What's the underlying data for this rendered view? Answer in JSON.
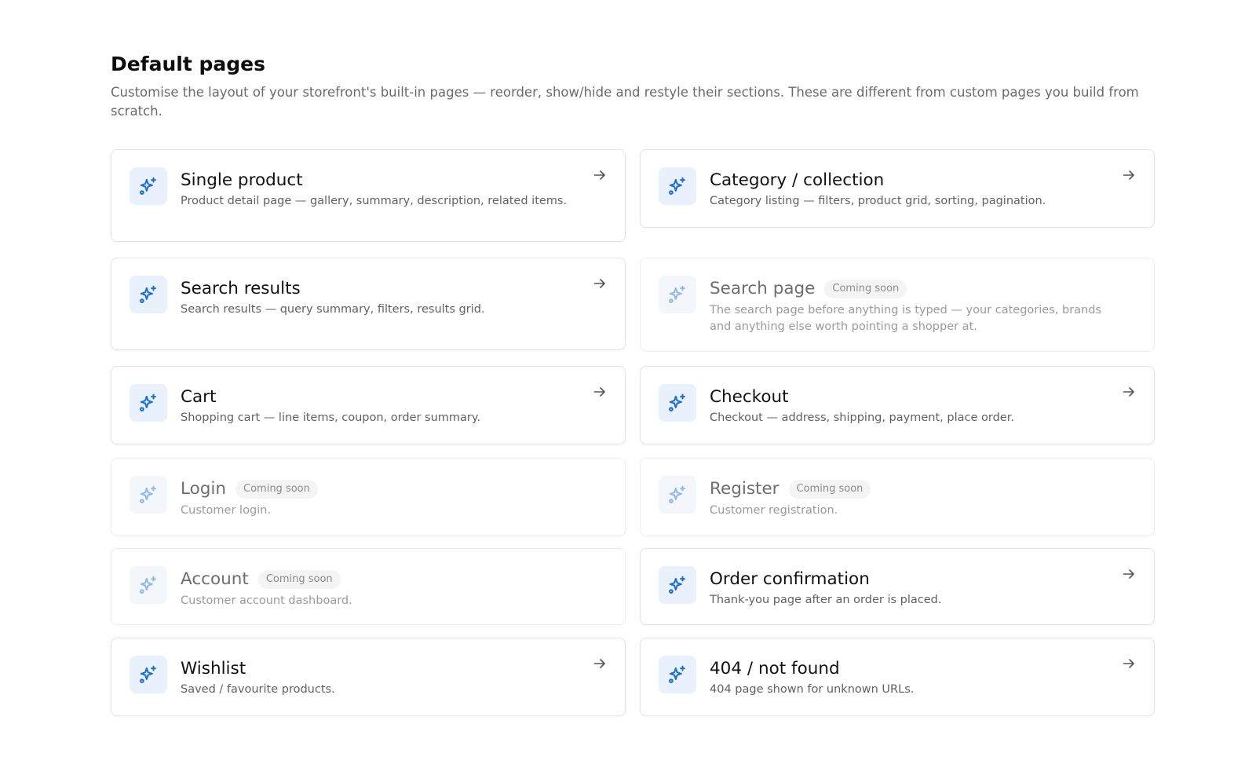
{
  "header": {
    "title": "Default pages",
    "description": "Customise the layout of your storefront's built-in pages — reorder, show/hide and restyle their sections. These are different from custom pages you build from scratch."
  },
  "colors": {
    "accent": "#1f6fd1",
    "icon_bg": "#e8f1fc"
  },
  "cards": [
    {
      "title": "Single product",
      "description": "Product detail page — gallery, summary, description, related items.",
      "badge": "",
      "enabled": true,
      "icon": "sparkles-icon"
    },
    {
      "title": "Category / collection",
      "description": "Category listing — filters, product grid, sorting, pagination.",
      "badge": "",
      "enabled": true,
      "icon": "sparkles-icon"
    },
    {
      "title": "Search results",
      "description": "Search results — query summary, filters, results grid.",
      "badge": "",
      "enabled": true,
      "icon": "sparkles-icon"
    },
    {
      "title": "Search page",
      "description": "The search page before anything is typed — your categories, brands and anything else worth pointing a shopper at.",
      "badge": "Coming soon",
      "enabled": false,
      "icon": "sparkles-icon"
    },
    {
      "title": "Cart",
      "description": "Shopping cart — line items, coupon, order summary.",
      "badge": "",
      "enabled": true,
      "icon": "sparkles-icon"
    },
    {
      "title": "Checkout",
      "description": "Checkout — address, shipping, payment, place order.",
      "badge": "",
      "enabled": true,
      "icon": "sparkles-icon"
    },
    {
      "title": "Login",
      "description": "Customer login.",
      "badge": "Coming soon",
      "enabled": false,
      "icon": "sparkles-icon"
    },
    {
      "title": "Register",
      "description": "Customer registration.",
      "badge": "Coming soon",
      "enabled": false,
      "icon": "sparkles-icon"
    },
    {
      "title": "Account",
      "description": "Customer account dashboard.",
      "badge": "Coming soon",
      "enabled": false,
      "icon": "sparkles-icon"
    },
    {
      "title": "Order confirmation",
      "description": "Thank-you page after an order is placed.",
      "badge": "",
      "enabled": true,
      "icon": "sparkles-icon"
    },
    {
      "title": "Wishlist",
      "description": "Saved / favourite products.",
      "badge": "",
      "enabled": true,
      "icon": "sparkles-icon"
    },
    {
      "title": "404 / not found",
      "description": "404 page shown for unknown URLs.",
      "badge": "",
      "enabled": true,
      "icon": "sparkles-icon"
    }
  ]
}
